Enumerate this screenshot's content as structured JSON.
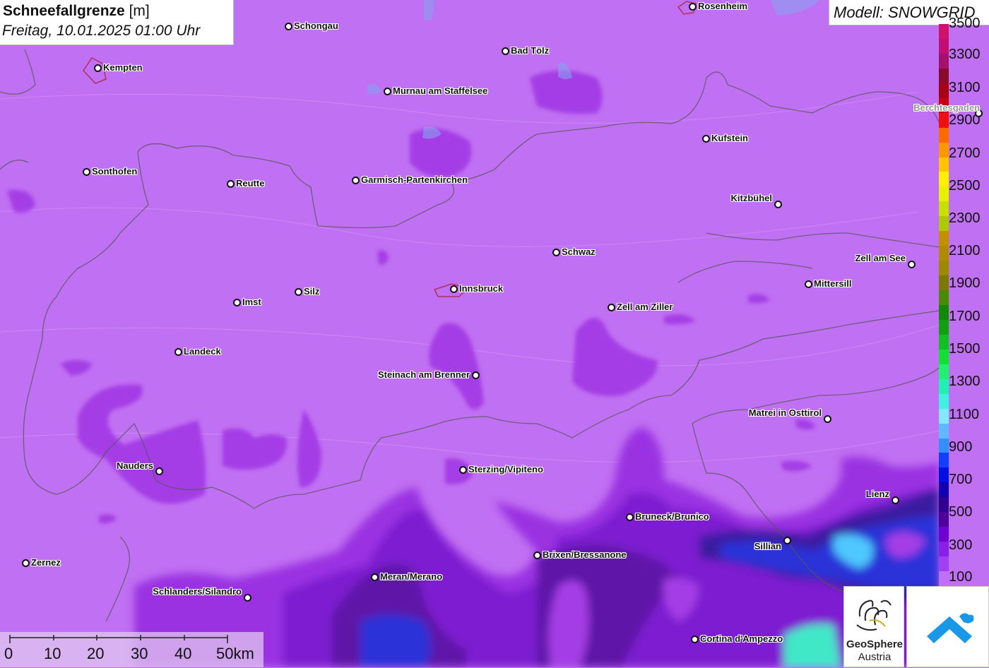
{
  "title": {
    "variable": "Schneefallgrenze",
    "unit": "[m]",
    "datetime": "Freitag, 10.01.2025 01:00 Uhr"
  },
  "model": "Modell: SNOWGRID",
  "legend": {
    "labels": [
      "3500",
      "3300",
      "3100",
      "2900",
      "2700",
      "2500",
      "2300",
      "2100",
      "1900",
      "1700",
      "1500",
      "1300",
      "1100",
      "900",
      "700",
      "500",
      "300",
      "100"
    ],
    "colors": [
      "#d0106a",
      "#c00e73",
      "#a5126e",
      "#8a0a2a",
      "#a80015",
      "#c80010",
      "#f01010",
      "#ff6a00",
      "#ff9800",
      "#ffc400",
      "#ffee00",
      "#e8f000",
      "#c8e000",
      "#b0c800",
      "#c09000",
      "#b08a00",
      "#9a8a00",
      "#7a7a00",
      "#4a8a00",
      "#108a00",
      "#10a010",
      "#10c020",
      "#10e030",
      "#20f070",
      "#20f0b0",
      "#40f0e0",
      "#80e8ff",
      "#60b8ff",
      "#3090ff",
      "#1040ff",
      "#0010e0",
      "#1000b0",
      "#300090",
      "#50009a",
      "#7000d0",
      "#8a20e8",
      "#a040f0",
      "#c070f8"
    ]
  },
  "cities": [
    {
      "name": "Rosenheim"
    },
    {
      "name": "Schongau"
    },
    {
      "name": "Kempten"
    },
    {
      "name": "Bad Tölz"
    },
    {
      "name": "Murnau am Staffelsee"
    },
    {
      "name": "Berchtesgaden"
    },
    {
      "name": "Kufstein"
    },
    {
      "name": "Sonthofen"
    },
    {
      "name": "Reutte"
    },
    {
      "name": "Garmisch-Partenkirchen"
    },
    {
      "name": "Kitzbühel"
    },
    {
      "name": "Schwaz"
    },
    {
      "name": "Zell am See"
    },
    {
      "name": "Mittersill"
    },
    {
      "name": "Innsbruck"
    },
    {
      "name": "Imst"
    },
    {
      "name": "Silz"
    },
    {
      "name": "Zell am Ziller"
    },
    {
      "name": "Landeck"
    },
    {
      "name": "Steinach am Brenner"
    },
    {
      "name": "Matrei in Osttirol"
    },
    {
      "name": "Nauders"
    },
    {
      "name": "Sterzing/Vipiteno"
    },
    {
      "name": "Lienz"
    },
    {
      "name": "Bruneck/Brunico"
    },
    {
      "name": "Sillian"
    },
    {
      "name": "Brixen/Bressanone"
    },
    {
      "name": "Zernez"
    },
    {
      "name": "Meran/Merano"
    },
    {
      "name": "Schlanders/Silandro"
    },
    {
      "name": "Cortina d'Ampezzo"
    }
  ],
  "scale_bar": {
    "labels": [
      "0",
      "10",
      "20",
      "30",
      "40",
      "50km"
    ]
  },
  "logos": {
    "geosphere_line1": "GeoSphere",
    "geosphere_line2": "Austria"
  }
}
